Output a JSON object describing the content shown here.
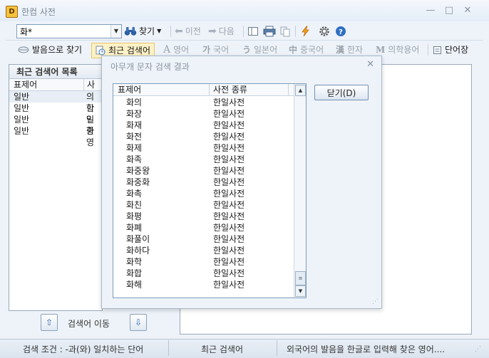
{
  "window": {
    "icon_letter": "D",
    "title": "한컴 사전",
    "min_glyph": "—",
    "max_glyph": "□",
    "close_glyph": "✕"
  },
  "toolbar": {
    "search_value": "화*",
    "search_label": "찾기",
    "prev_label": "이전",
    "next_label": "다음"
  },
  "lang_bar": {
    "pronunciation_label": "발음으로 찾기",
    "recent_label": "최근 검색어",
    "items": [
      {
        "glyph": "A",
        "label": "영어"
      },
      {
        "glyph": "가",
        "label": "국어"
      },
      {
        "glyph": "う",
        "label": "일본어"
      },
      {
        "glyph": "中",
        "label": "중국어"
      },
      {
        "glyph": "漢",
        "label": "한자"
      },
      {
        "glyph": "M",
        "label": "의학용어"
      }
    ],
    "wordbook_label": "단어장"
  },
  "left_panel": {
    "title": "최근 검색어 목록",
    "columns": [
      "표제어",
      "사전"
    ],
    "rows": [
      {
        "word": "일반",
        "dict": "의학"
      },
      {
        "word": "일반",
        "dict": "한일"
      },
      {
        "word": "일반",
        "dict": "민중"
      },
      {
        "word": "일반",
        "dict": "한영"
      }
    ]
  },
  "nav": {
    "label": "검색어 이동",
    "up_glyph": "⇧",
    "down_glyph": "⇩"
  },
  "status": {
    "condition": "검색 조건 : -과(와) 일치하는 단어",
    "mode": "최근 검색어",
    "hint": "외국어의 발음을 한글로 입력해 찾은 영어....",
    "grip": "⋰"
  },
  "dialog": {
    "title": "아무개 문자 검색 결과",
    "close_glyph": "✕",
    "columns": [
      "표제어",
      "사전 종류"
    ],
    "rows": [
      {
        "word": "화의",
        "dict": "한일사전"
      },
      {
        "word": "화장",
        "dict": "한일사전"
      },
      {
        "word": "화재",
        "dict": "한일사전"
      },
      {
        "word": "화전",
        "dict": "한일사전"
      },
      {
        "word": "화제",
        "dict": "한일사전"
      },
      {
        "word": "화족",
        "dict": "한일사전"
      },
      {
        "word": "화중왕",
        "dict": "한일사전"
      },
      {
        "word": "화중화",
        "dict": "한일사전"
      },
      {
        "word": "화촉",
        "dict": "한일사전"
      },
      {
        "word": "화친",
        "dict": "한일사전"
      },
      {
        "word": "화평",
        "dict": "한일사전"
      },
      {
        "word": "화폐",
        "dict": "한일사전"
      },
      {
        "word": "화풀이",
        "dict": "한일사전"
      },
      {
        "word": "화하다",
        "dict": "한일사전"
      },
      {
        "word": "화학",
        "dict": "한일사전"
      },
      {
        "word": "화합",
        "dict": "한일사전"
      },
      {
        "word": "화해",
        "dict": "한일사전"
      }
    ],
    "close_button": "닫기(D)",
    "scroll_up": "▲",
    "scroll_down": "▼",
    "scroll_thumb": "≡",
    "grip": "⋰"
  }
}
